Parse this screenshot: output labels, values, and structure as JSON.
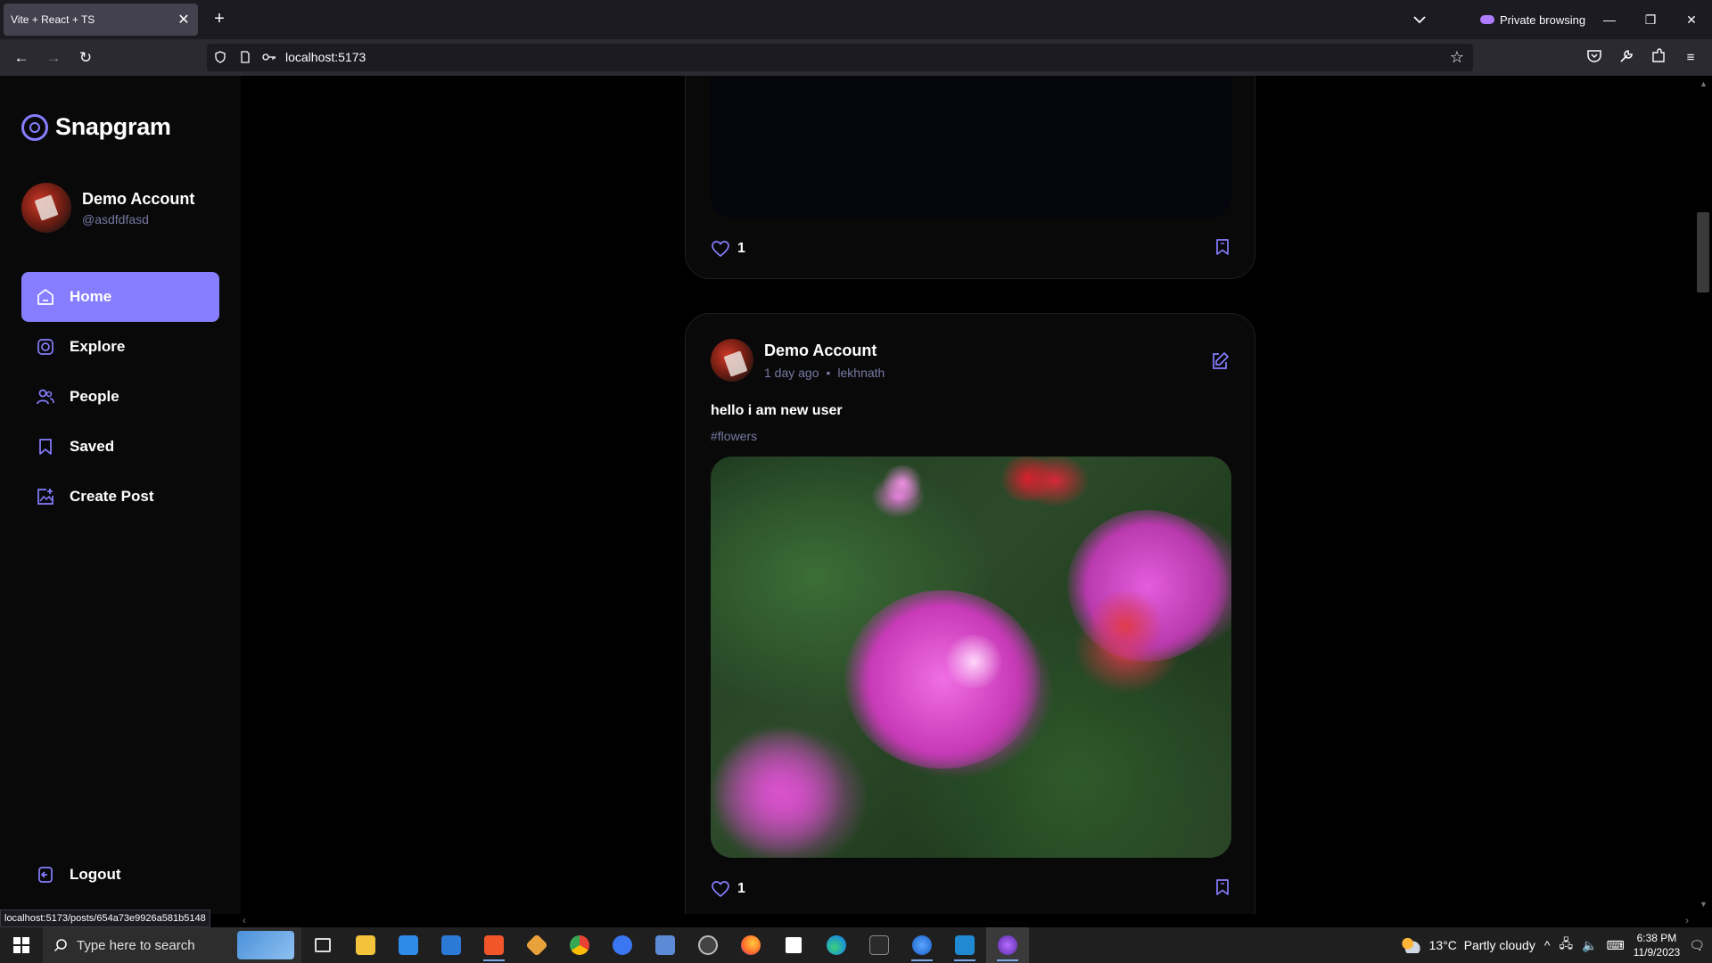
{
  "browser": {
    "tab_title": "Vite + React + TS",
    "tab_close": "✕",
    "new_tab": "+",
    "private_label": "Private browsing",
    "url": "localhost:5173",
    "status_url": "localhost:5173/posts/654a73e9926a581b5148"
  },
  "app": {
    "brand": "Snapgram",
    "user": {
      "name": "Demo Account",
      "handle": "@asdfdfasd"
    },
    "nav": [
      {
        "label": "Home",
        "icon": "home-icon",
        "active": true
      },
      {
        "label": "Explore",
        "icon": "explore-icon",
        "active": false
      },
      {
        "label": "People",
        "icon": "people-icon",
        "active": false
      },
      {
        "label": "Saved",
        "icon": "bookmark-icon",
        "active": false
      },
      {
        "label": "Create Post",
        "icon": "create-post-icon",
        "active": false
      }
    ],
    "logout_label": "Logout",
    "accent_color": "#877eff"
  },
  "posts": [
    {
      "likes": "1"
    },
    {
      "author": "Demo Account",
      "time": "1 day ago",
      "location": "lekhnath",
      "separator": "•",
      "caption": "hello i am new user",
      "tags": "#flowers",
      "likes": "1"
    }
  ],
  "taskbar": {
    "search_placeholder": "Type here to search",
    "weather": "13°C  Partly cloudy",
    "time": "6:38 PM",
    "date": "11/9/2023"
  }
}
